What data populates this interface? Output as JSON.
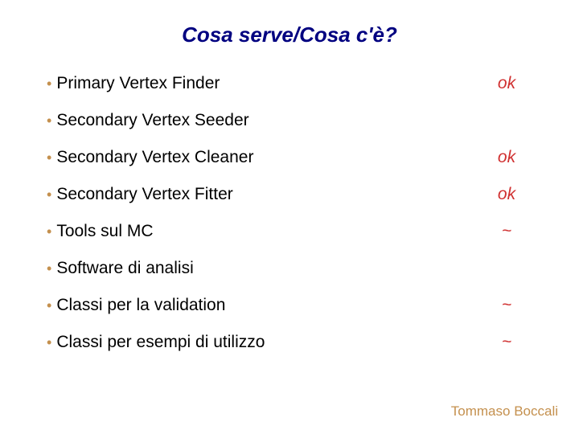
{
  "title": "Cosa serve/Cosa c'è?",
  "items": [
    {
      "label": "Primary Vertex Finder",
      "status": "ok"
    },
    {
      "label": "Secondary Vertex Seeder",
      "status": ""
    },
    {
      "label": "Secondary Vertex Cleaner",
      "status": "ok"
    },
    {
      "label": "Secondary Vertex Fitter",
      "status": "ok"
    },
    {
      "label": "Tools sul MC",
      "status": "~"
    },
    {
      "label": "Software di analisi",
      "status": ""
    },
    {
      "label": "Classi per la validation",
      "status": "~"
    },
    {
      "label": "Classi per esempi di utilizzo",
      "status": "~"
    }
  ],
  "author": "Tommaso Boccali"
}
